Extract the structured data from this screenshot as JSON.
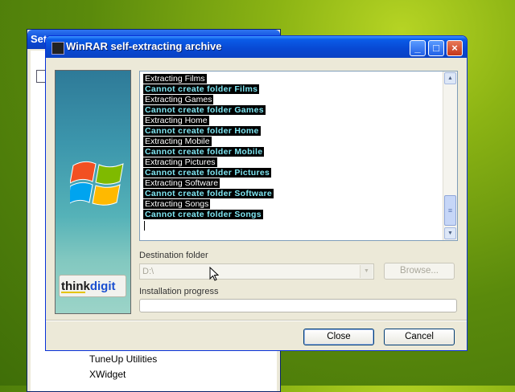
{
  "background_window": {
    "title": "Set",
    "items": [
      "TuneUp Utilities",
      "XWidget"
    ]
  },
  "window": {
    "title": "WinRAR self-extracting archive",
    "controls": {
      "minimize": "_",
      "maximize": "□",
      "close": "×"
    }
  },
  "sidebar": {
    "brand": "thinkdigit",
    "logo_icon": "windows-flag-icon"
  },
  "log": {
    "lines": [
      {
        "text": "Extracting Films",
        "type": "info"
      },
      {
        "text": "Cannot create folder Films",
        "type": "error"
      },
      {
        "text": "Extracting Games",
        "type": "info"
      },
      {
        "text": "Cannot create folder Games",
        "type": "error"
      },
      {
        "text": "Extracting Home",
        "type": "info"
      },
      {
        "text": "Cannot create folder Home",
        "type": "error"
      },
      {
        "text": "Extracting Mobile",
        "type": "info"
      },
      {
        "text": "Cannot create folder Mobile",
        "type": "error"
      },
      {
        "text": "Extracting Pictures",
        "type": "info"
      },
      {
        "text": "Cannot create folder Pictures",
        "type": "error"
      },
      {
        "text": "Extracting Software",
        "type": "info"
      },
      {
        "text": "Cannot create folder Software",
        "type": "error"
      },
      {
        "text": "Extracting Songs",
        "type": "info"
      },
      {
        "text": "Cannot create folder Songs",
        "type": "error"
      }
    ]
  },
  "destination": {
    "label": "Destination folder",
    "value": "D:\\",
    "browse_label": "Browse..."
  },
  "progress": {
    "label": "Installation progress",
    "fraction": 0
  },
  "buttons": {
    "close_label": "Close",
    "cancel_label": "Cancel"
  },
  "colors": {
    "title_bar": "#0a5ce8",
    "error_text": "#7fe6f2",
    "desktop": "#6a9a10"
  }
}
